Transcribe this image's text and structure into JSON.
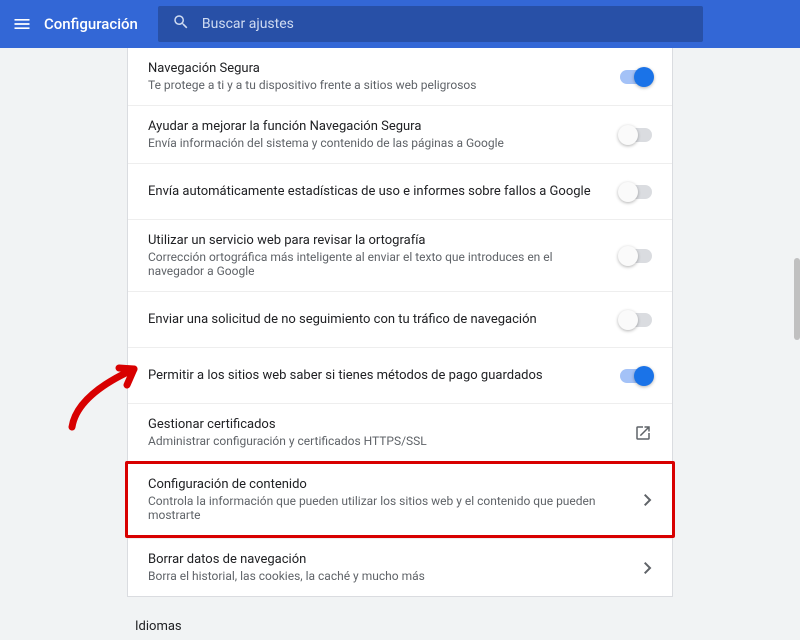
{
  "header": {
    "title": "Configuración",
    "search_placeholder": "Buscar ajustes"
  },
  "rows": [
    {
      "title": "Navegación Segura",
      "desc": "Te protege a ti y a tu dispositivo frente a sitios web peligrosos",
      "ctrl": "switch",
      "state": "on"
    },
    {
      "title": "Ayudar a mejorar la función Navegación Segura",
      "desc": "Envía información del sistema y contenido de las páginas a Google",
      "ctrl": "switch",
      "state": "off"
    },
    {
      "title": "Envía automáticamente estadísticas de uso e informes sobre fallos a Google",
      "desc": "",
      "ctrl": "switch",
      "state": "off"
    },
    {
      "title": "Utilizar un servicio web para revisar la ortografía",
      "desc": "Corrección ortográfica más inteligente al enviar el texto que introduces en el navegador a Google",
      "ctrl": "switch",
      "state": "off"
    },
    {
      "title": "Enviar una solicitud de no seguimiento con tu tráfico de navegación",
      "desc": "",
      "ctrl": "switch",
      "state": "off"
    },
    {
      "title": "Permitir a los sitios web saber si tienes métodos de pago guardados",
      "desc": "",
      "ctrl": "switch",
      "state": "on"
    },
    {
      "title": "Gestionar certificados",
      "desc": "Administrar configuración y certificados HTTPS/SSL",
      "ctrl": "external"
    },
    {
      "title": "Configuración de contenido",
      "desc": "Controla la información que pueden utilizar los sitios web y el contenido que pueden mostrarte",
      "ctrl": "arrow",
      "highlight": true
    },
    {
      "title": "Borrar datos de navegación",
      "desc": "Borra el historial, las cookies, la caché y mucho más",
      "ctrl": "arrow"
    }
  ],
  "section": {
    "title": "Idiomas"
  }
}
